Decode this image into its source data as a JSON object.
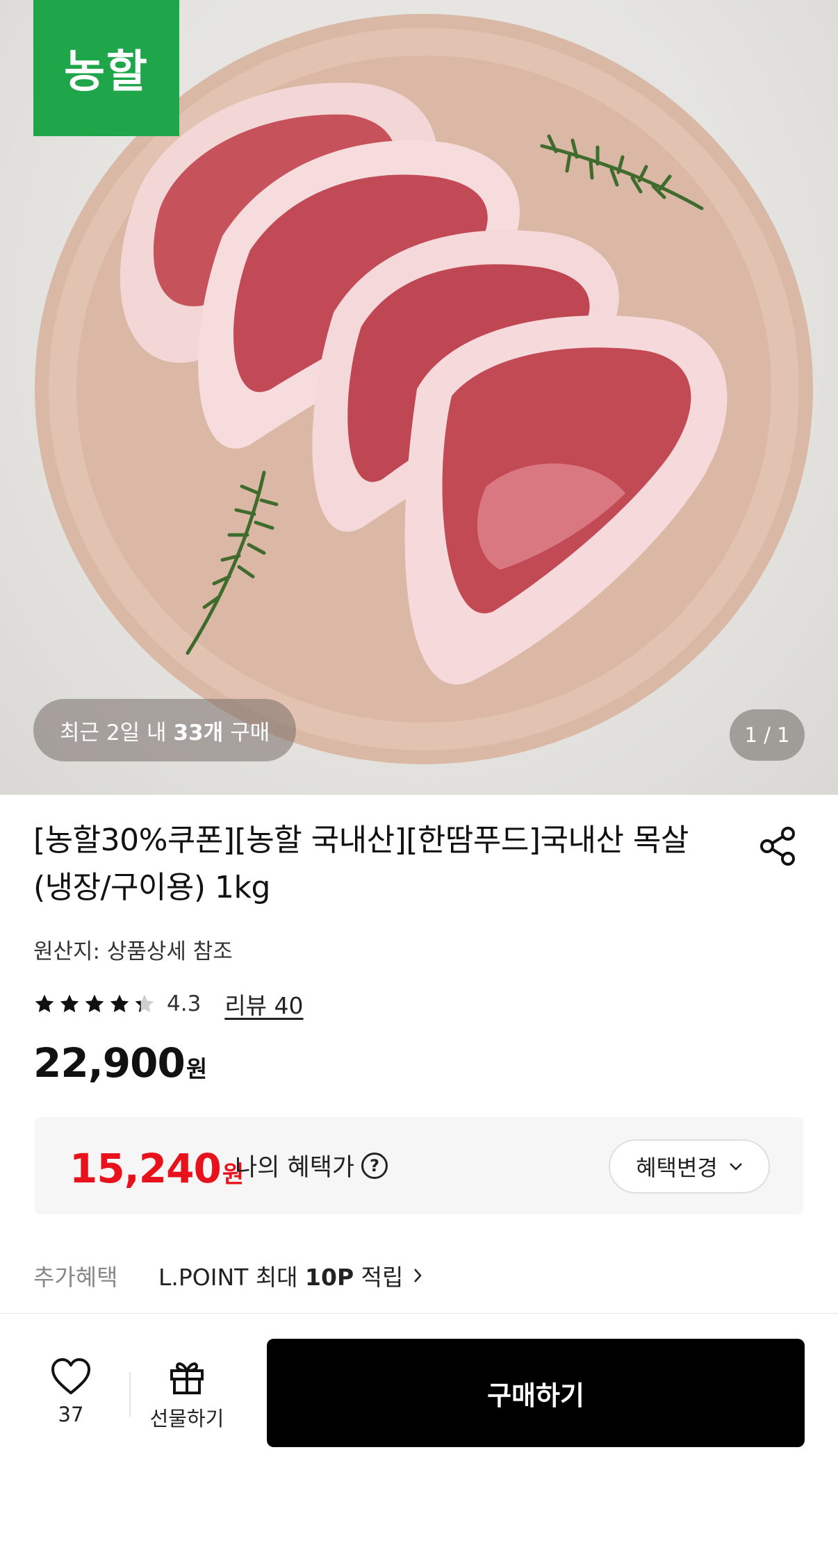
{
  "hero": {
    "brand_logo": "농할",
    "recent_purchase": {
      "prefix": "최근 2일 내",
      "count": "33개",
      "suffix": "구매"
    },
    "pager": "1 / 1"
  },
  "product": {
    "title": "[농할30%쿠폰][농할 국내산][한땀푸드]국내산 목살 (냉장/구이용) 1kg",
    "origin": "원산지: 상품상세 참조",
    "rating": {
      "value": "4.3",
      "stars": 4.3,
      "review_link": "리뷰 40"
    },
    "price": {
      "amount": "22,900",
      "unit": "원"
    },
    "benefit": {
      "amount": "15,240",
      "unit": "원",
      "label": "나의 혜택가",
      "help_icon": "?",
      "change_button": "혜택변경"
    },
    "extra_benefit": {
      "label": "추가혜택",
      "text_prefix": "L.POINT 최대",
      "text_bold": "10P",
      "text_suffix": "적립"
    }
  },
  "bottom_bar": {
    "like_count": "37",
    "gift_label": "선물하기",
    "buy_label": "구매하기"
  },
  "colors": {
    "brand_green": "#1fa64a",
    "benefit_red": "#e8121c",
    "buy_button": "#000000"
  }
}
